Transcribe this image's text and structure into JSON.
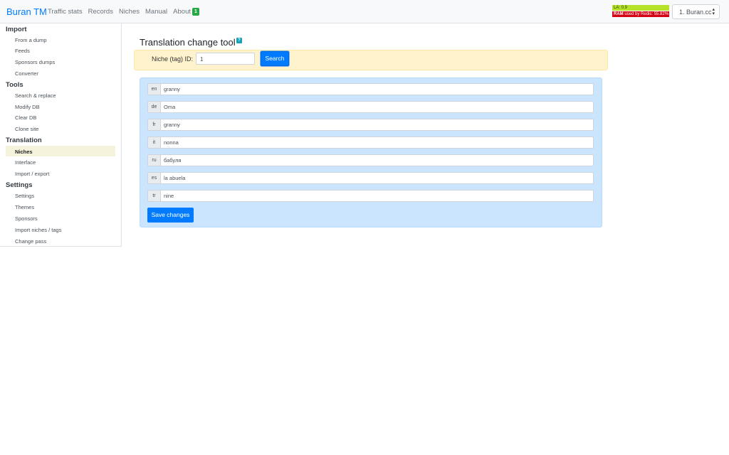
{
  "navbar": {
    "brand": "Buran TM",
    "links": [
      {
        "label": "Traffic stats"
      },
      {
        "label": "Records"
      },
      {
        "label": "Niches"
      },
      {
        "label": "Manual"
      },
      {
        "label": "About"
      }
    ],
    "about_badge": "1",
    "stats": {
      "la_text": "LA: 0.9",
      "ram_bold": "RAM",
      "ram_text": " used by Redis: 55.82%",
      "la_color": "#b6e32a",
      "ram_color": "#d60015"
    },
    "site_select": {
      "value": "1. Buran.cc",
      "caret": "▲▼"
    }
  },
  "sidebar": {
    "groups": [
      {
        "label": "Import"
      },
      {
        "label": "Tools"
      },
      {
        "label": "Translation"
      },
      {
        "label": "Settings"
      }
    ],
    "items": [
      {
        "label": "From a dump"
      },
      {
        "label": "Feeds"
      },
      {
        "label": "Sponsors dumps"
      },
      {
        "label": "Converter"
      },
      {
        "label": "Search & replace"
      },
      {
        "label": "Modify DB"
      },
      {
        "label": "Clear DB"
      },
      {
        "label": "Clone site"
      },
      {
        "label": "Niches",
        "active": true
      },
      {
        "label": "Interface"
      },
      {
        "label": "Import / export"
      },
      {
        "label": "Settings"
      },
      {
        "label": "Themes"
      },
      {
        "label": "Sponsors"
      },
      {
        "label": "Import niches / tags"
      },
      {
        "label": "Change pass"
      }
    ]
  },
  "main": {
    "title": "Translation change tool",
    "help_icon": "?",
    "search": {
      "label": "Niche (tag) ID:",
      "value": "1",
      "button": "Search"
    },
    "translations": [
      {
        "code": "en",
        "value": "granny"
      },
      {
        "code": "de",
        "value": "Oma"
      },
      {
        "code": "fr",
        "value": "granny"
      },
      {
        "code": "it",
        "value": "nonna"
      },
      {
        "code": "ru",
        "value": "бабуля"
      },
      {
        "code": "es",
        "value": "la abuela"
      },
      {
        "code": "tr",
        "value": "nine"
      }
    ],
    "save_button": "Save changes"
  },
  "colors": {
    "accent": "#007bff",
    "warning_bg": "#fff3cd",
    "info_bg": "#cce5ff",
    "active_item_bg": "#f5f3dc"
  }
}
